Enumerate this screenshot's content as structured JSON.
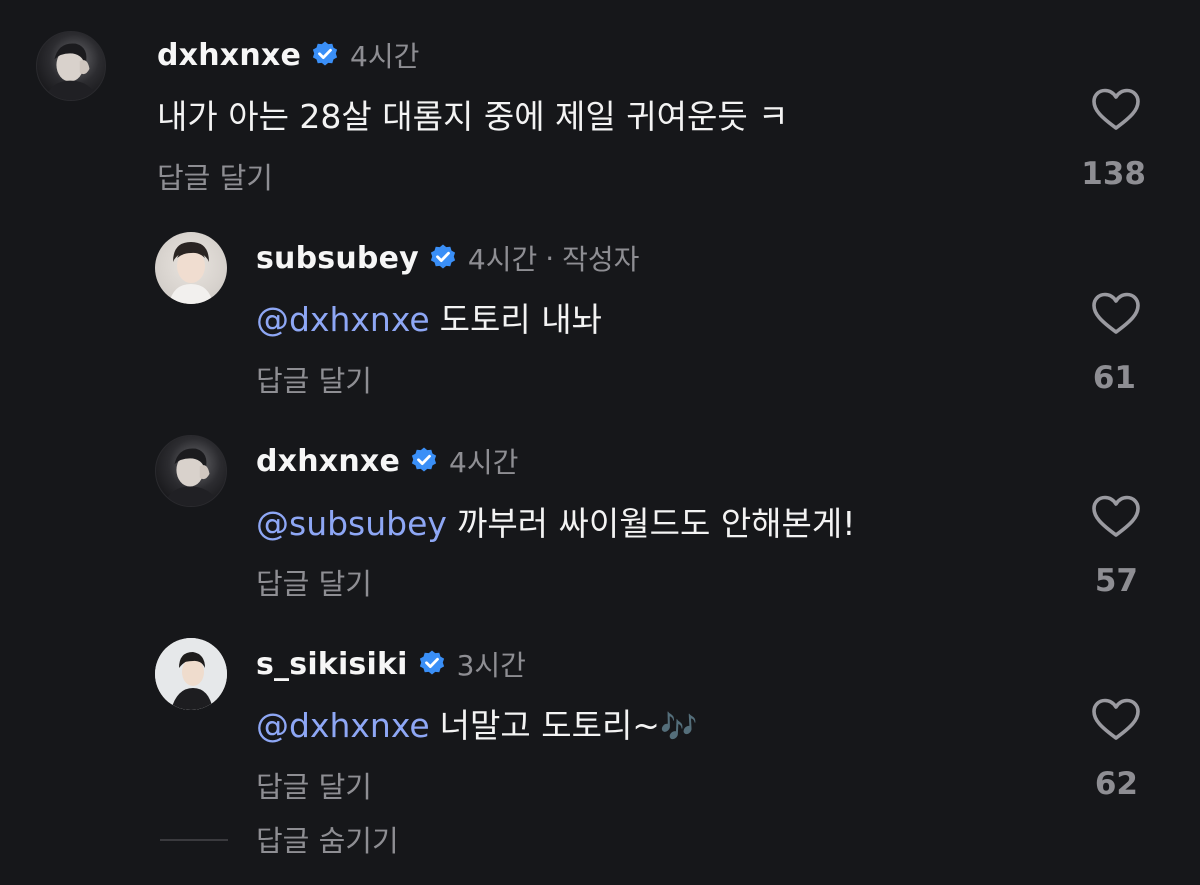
{
  "comments": [
    {
      "username": "dxhxnxe",
      "time": "4시간",
      "author_tag": "",
      "mention": "",
      "text": "내가 아는 28살 대롬지 중에 제일 귀여운듯 ㅋ",
      "reply_label": "답글 달기",
      "likes": "138"
    },
    {
      "username": "subsubey",
      "time": "4시간",
      "author_tag": "작성자",
      "mention": "@dxhxnxe",
      "text": "도토리 내놔",
      "reply_label": "답글 달기",
      "likes": "61"
    },
    {
      "username": "dxhxnxe",
      "time": "4시간",
      "author_tag": "",
      "mention": "@subsubey",
      "text": "까부러 싸이월드도 안해본게!",
      "reply_label": "답글 달기",
      "likes": "57"
    },
    {
      "username": "s_sikisiki",
      "time": "3시간",
      "author_tag": "",
      "mention": "@dxhxnxe",
      "text": "너말고 도토리~",
      "emoji": "🎶",
      "reply_label": "답글 달기",
      "likes": "62"
    }
  ],
  "hide_replies_label": "답글 숨기기",
  "icons": {
    "verified": "verified-badge-icon",
    "like": "heart-outline-icon"
  },
  "colors": {
    "background": "#16171a",
    "mention": "#8ea7f5",
    "verified": "#3a8ff7",
    "muted": "#8e8e93"
  }
}
